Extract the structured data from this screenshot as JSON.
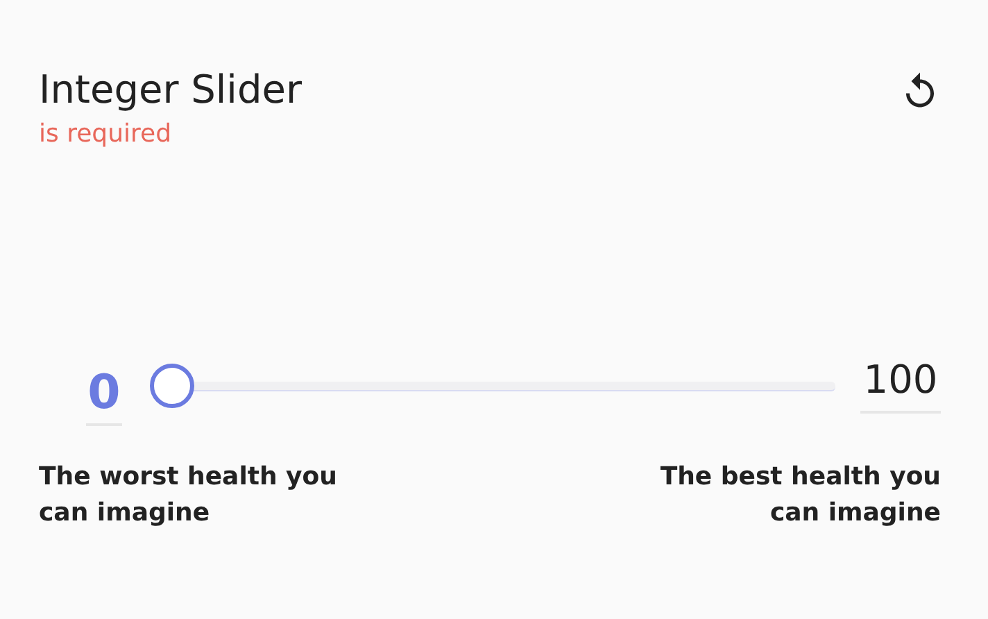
{
  "title": "Integer Slider",
  "error": "is required",
  "slider": {
    "value": "0",
    "max": "100",
    "level": 0
  },
  "min_label": "The worst health you can imagine",
  "max_label": "The best health you can imagine"
}
